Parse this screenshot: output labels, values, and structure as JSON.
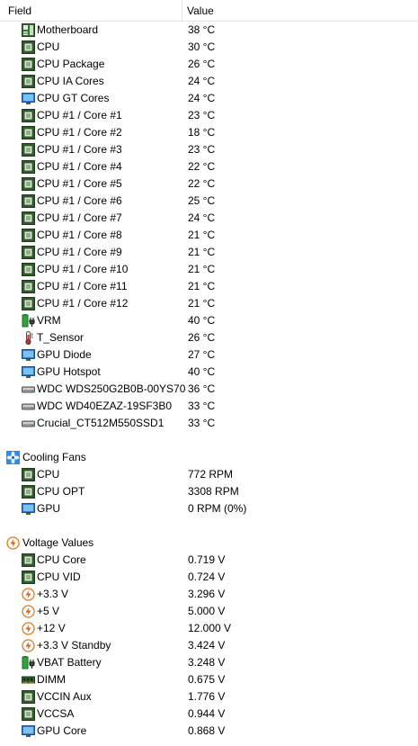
{
  "header": {
    "field_label": "Field",
    "value_label": "Value"
  },
  "rows": [
    {
      "kind": "child",
      "icon": "motherboard-icon",
      "field": "Motherboard",
      "value": "38 °C"
    },
    {
      "kind": "child",
      "icon": "cpu-chip-icon",
      "field": "CPU",
      "value": "30 °C"
    },
    {
      "kind": "child",
      "icon": "cpu-chip-icon",
      "field": "CPU Package",
      "value": "26 °C"
    },
    {
      "kind": "child",
      "icon": "cpu-chip-icon",
      "field": "CPU IA Cores",
      "value": "24 °C"
    },
    {
      "kind": "child",
      "icon": "monitor-icon",
      "field": "CPU GT Cores",
      "value": "24 °C"
    },
    {
      "kind": "child",
      "icon": "cpu-chip-icon",
      "field": "CPU #1 / Core #1",
      "value": "23 °C"
    },
    {
      "kind": "child",
      "icon": "cpu-chip-icon",
      "field": "CPU #1 / Core #2",
      "value": "18 °C"
    },
    {
      "kind": "child",
      "icon": "cpu-chip-icon",
      "field": "CPU #1 / Core #3",
      "value": "23 °C"
    },
    {
      "kind": "child",
      "icon": "cpu-chip-icon",
      "field": "CPU #1 / Core #4",
      "value": "22 °C"
    },
    {
      "kind": "child",
      "icon": "cpu-chip-icon",
      "field": "CPU #1 / Core #5",
      "value": "22 °C"
    },
    {
      "kind": "child",
      "icon": "cpu-chip-icon",
      "field": "CPU #1 / Core #6",
      "value": "25 °C"
    },
    {
      "kind": "child",
      "icon": "cpu-chip-icon",
      "field": "CPU #1 / Core #7",
      "value": "24 °C"
    },
    {
      "kind": "child",
      "icon": "cpu-chip-icon",
      "field": "CPU #1 / Core #8",
      "value": "21 °C"
    },
    {
      "kind": "child",
      "icon": "cpu-chip-icon",
      "field": "CPU #1 / Core #9",
      "value": "21 °C"
    },
    {
      "kind": "child",
      "icon": "cpu-chip-icon",
      "field": "CPU #1 / Core #10",
      "value": "21 °C"
    },
    {
      "kind": "child",
      "icon": "cpu-chip-icon",
      "field": "CPU #1 / Core #11",
      "value": "21 °C"
    },
    {
      "kind": "child",
      "icon": "cpu-chip-icon",
      "field": "CPU #1 / Core #12",
      "value": "21 °C"
    },
    {
      "kind": "child",
      "icon": "battery-plug-icon",
      "field": "VRM",
      "value": "40 °C"
    },
    {
      "kind": "child",
      "icon": "thermometer-icon",
      "field": "T_Sensor",
      "value": "26 °C"
    },
    {
      "kind": "child",
      "icon": "monitor-icon",
      "field": "GPU Diode",
      "value": "27 °C"
    },
    {
      "kind": "child",
      "icon": "monitor-icon",
      "field": "GPU Hotspot",
      "value": "40 °C"
    },
    {
      "kind": "child",
      "icon": "hard-drive-icon",
      "field": "WDC  WDS250G2B0B-00YS70",
      "value": "36 °C"
    },
    {
      "kind": "child",
      "icon": "hard-drive-icon",
      "field": "WDC WD40EZAZ-19SF3B0",
      "value": "33 °C"
    },
    {
      "kind": "child",
      "icon": "hard-drive-icon",
      "field": "Crucial_CT512M550SSD1",
      "value": "33 °C"
    },
    {
      "kind": "blank"
    },
    {
      "kind": "group",
      "icon": "fan-icon",
      "field": "Cooling Fans",
      "value": ""
    },
    {
      "kind": "child",
      "icon": "cpu-chip-icon",
      "field": "CPU",
      "value": "772 RPM"
    },
    {
      "kind": "child",
      "icon": "cpu-chip-icon",
      "field": "CPU OPT",
      "value": "3308 RPM"
    },
    {
      "kind": "child",
      "icon": "monitor-icon",
      "field": "GPU",
      "value": "0 RPM  (0%)"
    },
    {
      "kind": "blank"
    },
    {
      "kind": "group",
      "icon": "lightning-icon",
      "field": "Voltage Values",
      "value": ""
    },
    {
      "kind": "child",
      "icon": "cpu-chip-icon",
      "field": "CPU Core",
      "value": "0.719 V"
    },
    {
      "kind": "child",
      "icon": "cpu-chip-icon",
      "field": "CPU VID",
      "value": "0.724 V"
    },
    {
      "kind": "child",
      "icon": "lightning-icon",
      "field": "+3.3 V",
      "value": "3.296 V"
    },
    {
      "kind": "child",
      "icon": "lightning-icon",
      "field": "+5 V",
      "value": "5.000 V"
    },
    {
      "kind": "child",
      "icon": "lightning-icon",
      "field": "+12 V",
      "value": "12.000 V"
    },
    {
      "kind": "child",
      "icon": "lightning-icon",
      "field": "+3.3 V Standby",
      "value": "3.424 V"
    },
    {
      "kind": "child",
      "icon": "battery-plug-icon",
      "field": "VBAT Battery",
      "value": "3.248 V"
    },
    {
      "kind": "child",
      "icon": "memory-module-icon",
      "field": "DIMM",
      "value": "0.675 V"
    },
    {
      "kind": "child",
      "icon": "cpu-chip-icon",
      "field": "VCCIN Aux",
      "value": "1.776 V"
    },
    {
      "kind": "child",
      "icon": "cpu-chip-icon",
      "field": "VCCSA",
      "value": "0.944 V"
    },
    {
      "kind": "child",
      "icon": "monitor-icon",
      "field": "GPU Core",
      "value": "0.868 V"
    }
  ]
}
